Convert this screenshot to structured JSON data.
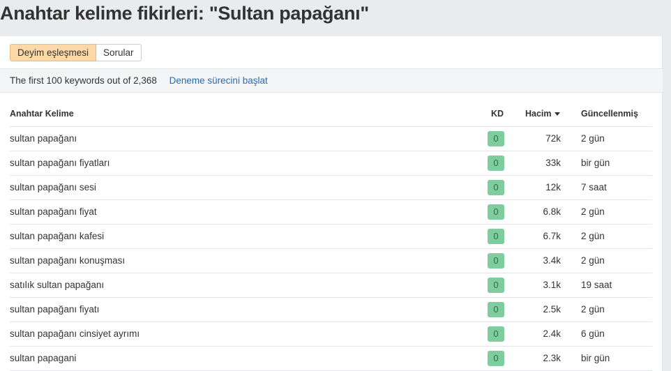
{
  "page": {
    "title": "Anahtar kelime fikirleri: \"Sultan papağanı\""
  },
  "tabs": [
    {
      "label": "Deyim eşleşmesi",
      "active": true
    },
    {
      "label": "Sorular",
      "active": false
    }
  ],
  "info": {
    "text": "The first 100 keywords out of 2,368",
    "trial_link": "Deneme sürecini başlat"
  },
  "table": {
    "headers": {
      "keyword": "Anahtar Kelime",
      "kd": "KD",
      "volume": "Hacim",
      "updated": "Güncellenmiş"
    },
    "sort": {
      "column": "volume",
      "direction": "desc"
    },
    "rows": [
      {
        "keyword": "sultan papağanı",
        "kd": "0",
        "volume": "72k",
        "updated": "2 gün"
      },
      {
        "keyword": "sultan papağanı fiyatları",
        "kd": "0",
        "volume": "33k",
        "updated": "bir gün"
      },
      {
        "keyword": "sultan papağanı sesi",
        "kd": "0",
        "volume": "12k",
        "updated": "7 saat"
      },
      {
        "keyword": "sultan papağanı fiyat",
        "kd": "0",
        "volume": "6.8k",
        "updated": "2 gün"
      },
      {
        "keyword": "sultan papağanı kafesi",
        "kd": "0",
        "volume": "6.7k",
        "updated": "2 gün"
      },
      {
        "keyword": "sultan papağanı konuşması",
        "kd": "0",
        "volume": "3.4k",
        "updated": "2 gün"
      },
      {
        "keyword": "satılık sultan papağanı",
        "kd": "0",
        "volume": "3.1k",
        "updated": "19 saat"
      },
      {
        "keyword": "sultan papağanı fiyatı",
        "kd": "0",
        "volume": "2.5k",
        "updated": "2 gün"
      },
      {
        "keyword": "sultan papağanı cinsiyet ayrımı",
        "kd": "0",
        "volume": "2.4k",
        "updated": "6 gün"
      },
      {
        "keyword": "sultan papagani",
        "kd": "0",
        "volume": "2.3k",
        "updated": "bir gün"
      }
    ]
  },
  "colors": {
    "page_background": "#e9ebee",
    "active_tab": "#fcd9a6",
    "kd_badge": "#7fcc9f",
    "link": "#2a6ab0"
  }
}
